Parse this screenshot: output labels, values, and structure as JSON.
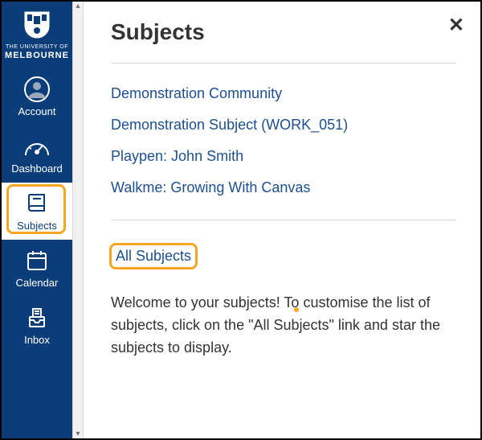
{
  "institution": {
    "line1": "THE UNIVERSITY OF",
    "line2": "MELBOURNE"
  },
  "sidebar": {
    "items": [
      {
        "label": "Account"
      },
      {
        "label": "Dashboard"
      },
      {
        "label": "Subjects"
      },
      {
        "label": "Calendar"
      },
      {
        "label": "Inbox"
      }
    ]
  },
  "panel": {
    "title": "Subjects",
    "subjects": [
      "Demonstration Community",
      "Demonstration Subject (WORK_051)",
      "Playpen: John Smith",
      "Walkme: Growing With Canvas"
    ],
    "all_link": "All Subjects",
    "welcome": "Welcome to your subjects! To customise the list of subjects, click on the \"All Subjects\" link and star the subjects to display."
  }
}
